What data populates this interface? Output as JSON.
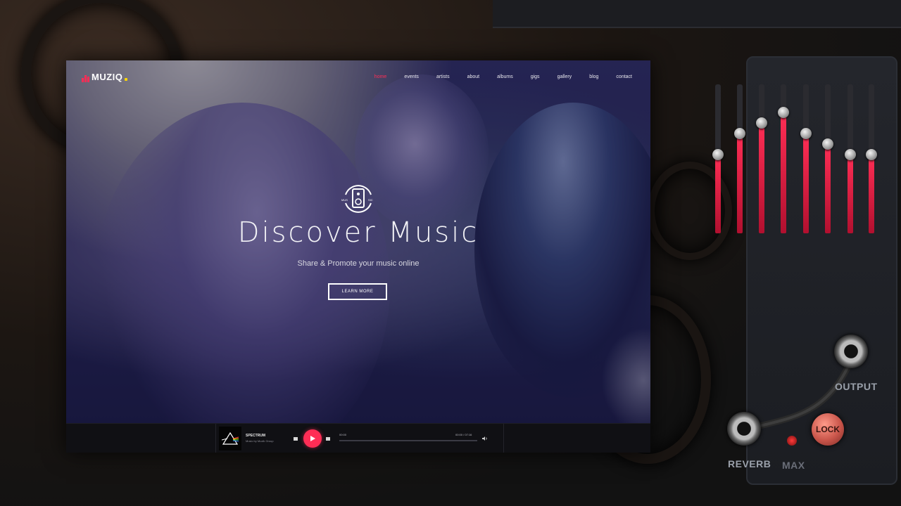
{
  "site": {
    "logo": "MUZIQ",
    "nav": [
      {
        "label": "home",
        "active": true
      },
      {
        "label": "events",
        "active": false
      },
      {
        "label": "artists",
        "active": false
      },
      {
        "label": "about",
        "active": false
      },
      {
        "label": "albums",
        "active": false
      },
      {
        "label": "gigs",
        "active": false
      },
      {
        "label": "gallery",
        "active": false
      },
      {
        "label": "blog",
        "active": false
      },
      {
        "label": "contact",
        "active": false
      }
    ],
    "hero": {
      "title": "Discover Music",
      "subtitle": "Share & Promote your music online",
      "button": "LEARN MORE"
    },
    "player": {
      "track_title": "SPECTRUM",
      "track_artist": "Music by Muzik Group",
      "time_current": "00:00",
      "time_total": "00:00 / 07:16",
      "progress": 0
    }
  },
  "panel": {
    "eq_levels": [
      0.53,
      0.67,
      0.74,
      0.81,
      0.67,
      0.6,
      0.53,
      0.53
    ],
    "labels": {
      "output": "OUTPUT",
      "reverb": "REVERB",
      "max": "MAX",
      "lock": "LOCK"
    }
  },
  "colors": {
    "accent": "#ff2d55",
    "logo_dot": "#ffd600",
    "eq_fill": "#d4173e"
  }
}
